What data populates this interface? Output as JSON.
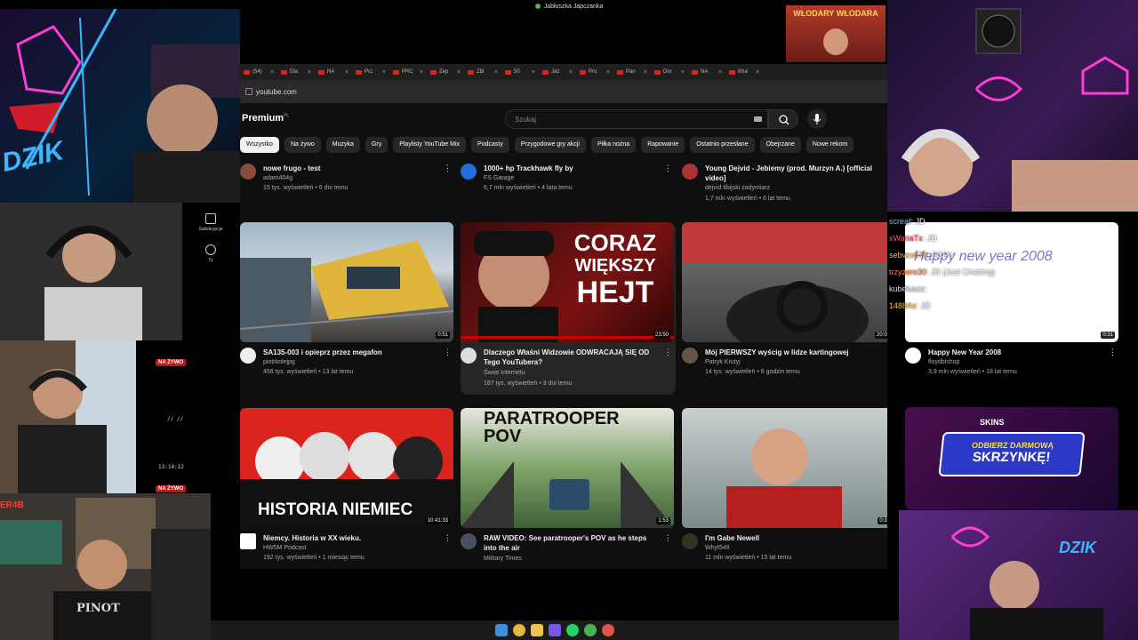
{
  "window": {
    "title": "Jabłuszka Japczanka"
  },
  "browser": {
    "tabs": [
      "(54)",
      "Dla",
      "NA",
      "Prz",
      "PRC",
      "Zep",
      "Zbl",
      "50",
      "Jaz",
      "Pro",
      "Pan",
      "Dor",
      "NA",
      "Kha"
    ],
    "url": "youtube.com"
  },
  "youtube": {
    "logo": "Premium",
    "logo_region": "PL",
    "search_placeholder": "Szukaj",
    "chips": [
      "Wszystko",
      "Na żywo",
      "Muzyka",
      "Gry",
      "Playlisty YouTube Mix",
      "Podcasty",
      "Przygodowe gry akcji",
      "Piłka nożna",
      "Rapowanie",
      "Ostatnio przesłane",
      "Obejrzane",
      "Nowe rekom"
    ],
    "sidebar": [
      {
        "label": "Subskrypcje",
        "icon": "subscriptions-icon"
      },
      {
        "label": "Ty",
        "icon": "you-icon"
      }
    ],
    "row0": [
      {
        "title": "nowe frugo - test",
        "channel": "adam404g",
        "stats": "15 tys. wyświetleń • 6 dni temu"
      },
      {
        "title": "1000+ hp Trackhawk fly by",
        "channel": "FS Garage",
        "stats": "6,7 mln wyświetleń • 4 lata temu"
      },
      {
        "title": "Young Dejvid - Jebiemy (prod. Murzyn A.) [official video]",
        "channel": "dejvid tibijski zadymiarz",
        "stats": "1,7 mln wyświetleń • 6 lat temu"
      }
    ],
    "row1": [
      {
        "title": "SA135-003 i opieprz przez megafon",
        "channel": "piotrkolejpg",
        "stats": "456 tys. wyświetleń • 13 lat temu",
        "duration": "0:51"
      },
      {
        "title": "Dlaczego Właśni Widzowie ODWRACAJĄ SIĘ OD Tego YouTubera?",
        "channel": "Świat Internetu",
        "stats": "187 tys. wyświetleń • 3 dni temu",
        "duration": "23:50",
        "thumb_text": [
          "CORAZ",
          "WIĘKSZY",
          "HEJT"
        ]
      },
      {
        "title": "Mój PIERWSZY wyścig w lidze kartingowej",
        "channel": "Patryk Krutyj",
        "stats": "14 tys. wyświetleń • 6 godzin temu",
        "duration": "20:02"
      },
      {
        "title": "Happy New Year 2008",
        "channel": "floydbishop",
        "stats": "3,9 mln wyświetleń • 18 lat temu",
        "duration": "0:31",
        "thumb_text": "Happy new year 2008"
      }
    ],
    "row2": [
      {
        "title": "Niemcy. Historia w XX wieku.",
        "channel": "HW5M Podcast",
        "stats": "192 tys. wyświetleń • 1 miesiąc temu",
        "duration": "10:41:33",
        "thumb_text": "HISTORIA NIEMIEC"
      },
      {
        "title": "RAW VIDEO: See paratrooper's POV as he steps into the air",
        "channel": "Military Times",
        "stats": "",
        "duration": "1:53",
        "thumb_text": [
          "PARATROOPER",
          "POV"
        ]
      },
      {
        "title": "I'm Gabe Newell",
        "channel": "Whyt546",
        "stats": "11 mln wyświetleń • 15 lat temu",
        "duration": "0:35"
      }
    ],
    "ad": {
      "brand": "SKINS",
      "line1": "ODBIERZ DARMOWĄ",
      "line2": "SKRZYNKĘ!"
    }
  },
  "overlays": {
    "brand_text": "DZIK",
    "live_badge": "NA ŻYWO",
    "cam_time": "13:14:12",
    "cam_time2": "// //",
    "poster_text": "WŁODARY WŁODARA",
    "cam_tag": "ER4B",
    "shirt_text": "PINOT"
  },
  "chat": [
    {
      "user": "screaf",
      "text": "JD"
    },
    {
      "user": "xWariaTx",
      "text": "JD"
    },
    {
      "user": "sebvzx678",
      "text": "ECPU"
    },
    {
      "user": "trzyzero30",
      "text": "JD (Just Chatting)"
    },
    {
      "user": "kubeluszz",
      "text": ""
    },
    {
      "user": "1488As",
      "text": "JD"
    }
  ],
  "colors": {
    "live_red": "#c4151c",
    "neon_pink": "#ff3dd6",
    "neon_blue": "#3ab8ff"
  }
}
